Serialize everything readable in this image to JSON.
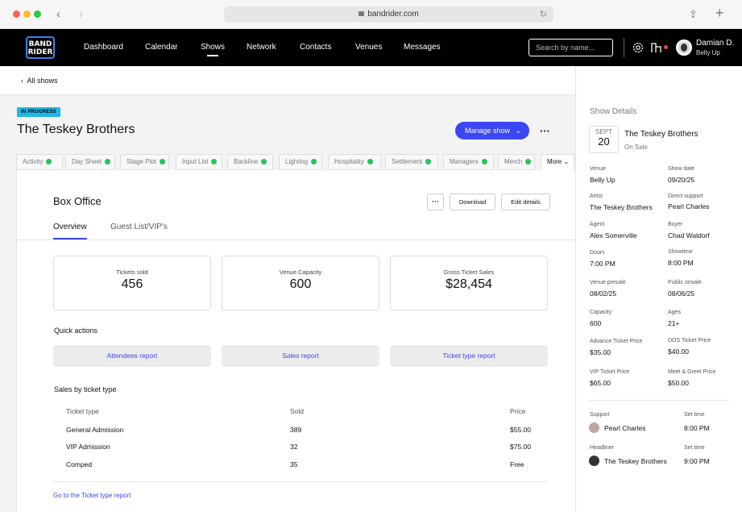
{
  "browser": {
    "url": "bandrider.com"
  },
  "app": {
    "logo": "BAND RIDER",
    "nav": [
      "Dashboard",
      "Calendar",
      "Shows",
      "Network",
      "Contacts",
      "Venues",
      "Messages"
    ],
    "search_placeholder": "Search by name...",
    "user": {
      "name": "Damian D.",
      "venue": "Belly Up"
    }
  },
  "page": {
    "back": "All shows",
    "status": "IN PROGRESS",
    "title": "The Teskey Brothers",
    "manage_label": "Manage show",
    "tabs": [
      "Activity",
      "Day Sheet",
      "Stage Plot",
      "Input List",
      "Backline",
      "Lighting",
      "Hospitality",
      "Settlement",
      "Managers",
      "Merch"
    ],
    "more_tab": "More"
  },
  "box_office": {
    "title": "Box Office",
    "download": "Download",
    "edit": "Edit details",
    "subtabs": [
      "Overview",
      "Guest List/VIP's"
    ],
    "stats": [
      {
        "label": "Tickets sold",
        "value": "456"
      },
      {
        "label": "Venue Capacity",
        "value": "600"
      },
      {
        "label": "Gross Ticket Sales",
        "value": "$28,454"
      }
    ],
    "quick_actions_title": "Quick actions",
    "quick_actions": [
      "Attendees report",
      "Sales report",
      "Ticket type report"
    ],
    "sales_title": "Sales by ticket type",
    "table_headers": [
      "Ticket type",
      "Sold",
      "Price"
    ],
    "rows": [
      [
        "General Admission",
        "389",
        "$55.00"
      ],
      [
        "VIP Admission",
        "32",
        "$75.00"
      ],
      [
        "Comped",
        "35",
        "Free"
      ]
    ],
    "report_link": "Go to the Ticket type report"
  },
  "details": {
    "heading": "Show Details",
    "month": "SEPT",
    "day": "20",
    "title": "The Teskey Brothers",
    "status": "On Sale",
    "fields": [
      [
        "Venue",
        "Belly Up"
      ],
      [
        "Show date",
        "09/20/25"
      ],
      [
        "Artist",
        "The Teskey Brothers"
      ],
      [
        "Direct support",
        "Pearl Charles"
      ],
      [
        "Agent",
        "Alex Somerville"
      ],
      [
        "Buyer",
        "Chad Waldorf"
      ],
      [
        "Doors",
        "7:00 PM"
      ],
      [
        "Showtime",
        "8:00 PM"
      ],
      [
        "Venue presale",
        "08/02/25"
      ],
      [
        "Public onsale",
        "08/06/25"
      ],
      [
        "Capacity",
        "600"
      ],
      [
        "Ages",
        "21+"
      ],
      [
        "Advance Ticket Price",
        "$35.00"
      ],
      [
        "DOS Ticket Price",
        "$40.00"
      ],
      [
        "VIP Ticket Price",
        "$65.00"
      ],
      [
        "Meet & Greet Price",
        "$50.00"
      ]
    ],
    "lineup": [
      {
        "role": "Support",
        "name": "Pearl Charles",
        "set_label": "Set time",
        "time": "8:00 PM"
      },
      {
        "role": "Headliner",
        "name": "The Teskey Brothers",
        "set_label": "Set time",
        "time": "9:00 PM"
      }
    ]
  }
}
